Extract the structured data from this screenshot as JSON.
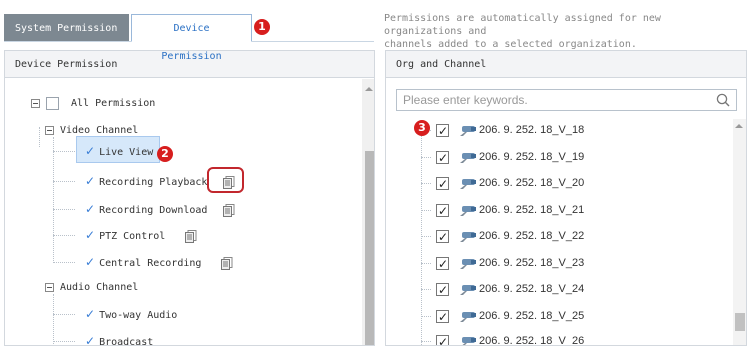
{
  "tabs": {
    "system_permission": "System Permission",
    "device_permission": "Device Permission"
  },
  "hint": {
    "line1": "Permissions are automatically assigned for new organizations and",
    "line2": "channels added to a selected organization."
  },
  "markers": {
    "m1": "1",
    "m2": "2",
    "m3": "3"
  },
  "left_panel": {
    "title": "Device Permission",
    "all_permission": "All Permission",
    "video_channel": {
      "label": "Video Channel",
      "items": [
        "Live View",
        "Recording Playback",
        "Recording Download",
        "PTZ Control",
        "Central Recording"
      ]
    },
    "audio_channel": {
      "label": "Audio Channel",
      "items": [
        "Two-way Audio",
        "Broadcast"
      ]
    }
  },
  "right_panel": {
    "title": "Org and Channel",
    "search_placeholder": "Please enter keywords.",
    "channels": [
      "206. 9. 252. 18_V_18",
      "206. 9. 252. 18_V_19",
      "206. 9. 252. 18_V_20",
      "206. 9. 252. 18_V_21",
      "206. 9. 252. 18_V_22",
      "206. 9. 252. 18_V_23",
      "206. 9. 252. 18_V_24",
      "206. 9. 252. 18_V_25",
      "206. 9. 252. 18_V_26"
    ]
  },
  "colors": {
    "accent_blue": "#3a7ed6",
    "marker_red": "#d71e1e",
    "tab_gray": "#7d8891",
    "selection_bg": "#d6e8fa"
  },
  "icons": {
    "check": "check-icon",
    "document": "document-copy-icon",
    "camera": "camera-icon",
    "search": "search-icon"
  }
}
